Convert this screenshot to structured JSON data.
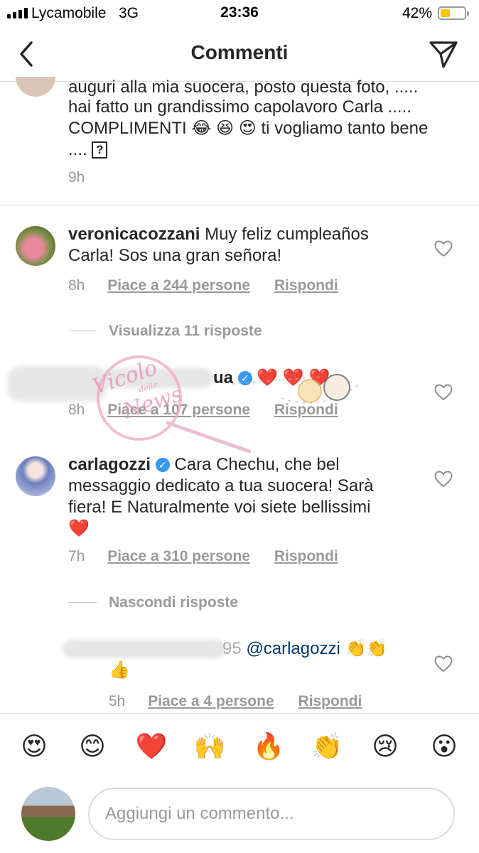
{
  "status_bar": {
    "carrier": "Lycamobile",
    "network": "3G",
    "time": "23:36",
    "battery_percent": "42%",
    "battery_level": 0.42,
    "battery_color": "#f2c500"
  },
  "header": {
    "title": "Commenti",
    "back_icon": "chevron-left-icon",
    "send_icon": "paper-plane-icon"
  },
  "top_comment": {
    "line1": "auguri alla mia suocera, posto questa foto, .....",
    "line2": "hai fatto un grandissimo  capolavoro Carla .....",
    "line3_text": "COMPLIMENTI",
    "line3_end": "ti vogliamo tanto bene",
    "line4": "....",
    "question_box": "?",
    "time": "9h"
  },
  "comments": [
    {
      "username": "veronicacozzani",
      "text_line1": " Muy feliz cumpleaños",
      "text_line2": "Carla! Sos una gran señora!",
      "time": "8h",
      "likes": "Piace a 244 persone",
      "reply": "Rispondi",
      "view_replies": "Visualizza 11 risposte"
    },
    {
      "username_visible": "ua",
      "time": "8h",
      "likes": "Piace a 107 persone",
      "reply": "Rispondi"
    },
    {
      "username": "carlagozzi",
      "text_line1": " Cara Chechu, che bel",
      "text_line2": "messaggio dedicato a tua suocera! Sarà",
      "text_line3": "fiera! E Naturalmente voi siete bellissimi",
      "time": "7h",
      "likes": "Piace a 310 persone",
      "reply": "Rispondi",
      "hide_replies": "Nascondi risposte"
    },
    {
      "username_visible": "95",
      "mention": "@carlagozzi",
      "time": "5h",
      "likes": "Piace a 4 persone",
      "reply": "Rispondi"
    }
  ],
  "watermark": {
    "line1": "Vicolo",
    "line2": "News",
    "small": "delle"
  },
  "emoji_bar": [
    "😍",
    "😊",
    "❤️",
    "🙌",
    "🔥",
    "👏",
    "😢",
    "😮"
  ],
  "comment_input": {
    "placeholder": "Aggiungi un commento..."
  }
}
